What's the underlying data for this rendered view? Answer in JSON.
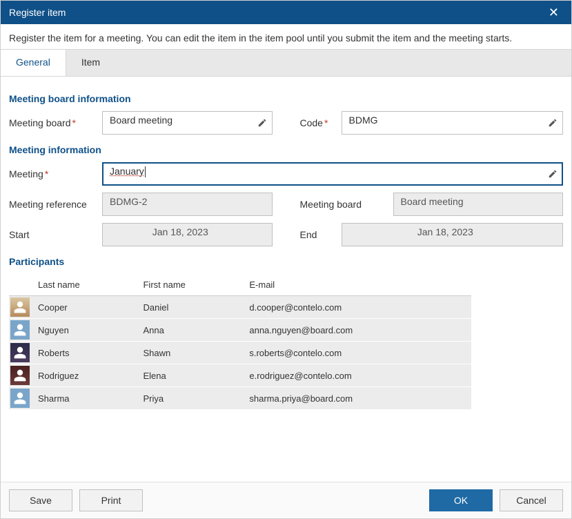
{
  "titlebar": {
    "title": "Register item"
  },
  "subheader": "Register the item for a meeting. You can edit the item in the item pool until you submit the item and the meeting starts.",
  "tabs": {
    "general": "General",
    "item": "Item"
  },
  "sections": {
    "board_info": "Meeting board information",
    "meeting_info": "Meeting information",
    "participants": "Participants"
  },
  "labels": {
    "meeting_board": "Meeting board",
    "code": "Code",
    "meeting": "Meeting",
    "meeting_reference": "Meeting reference",
    "meeting_board2": "Meeting board",
    "start": "Start",
    "end": "End"
  },
  "values": {
    "meeting_board": "Board meeting",
    "code": "BDMG",
    "meeting": "January",
    "meeting_reference": "BDMG-2",
    "meeting_board2": "Board meeting",
    "start": "Jan 18, 2023",
    "end": "Jan 18, 2023"
  },
  "participants": {
    "headers": {
      "last": "Last name",
      "first": "First name",
      "email": "E-mail"
    },
    "rows": [
      {
        "last": "Cooper",
        "first": "Daniel",
        "email": "d.cooper@contelo.com",
        "avatar": "photo1"
      },
      {
        "last": "Nguyen",
        "first": "Anna",
        "email": "anna.nguyen@board.com",
        "avatar": "generic"
      },
      {
        "last": "Roberts",
        "first": "Shawn",
        "email": "s.roberts@contelo.com",
        "avatar": "photo2"
      },
      {
        "last": "Rodriguez",
        "first": "Elena",
        "email": "e.rodriguez@contelo.com",
        "avatar": "photo3"
      },
      {
        "last": "Sharma",
        "first": "Priya",
        "email": "sharma.priya@board.com",
        "avatar": "generic"
      }
    ]
  },
  "footer": {
    "save": "Save",
    "print": "Print",
    "ok": "OK",
    "cancel": "Cancel"
  }
}
